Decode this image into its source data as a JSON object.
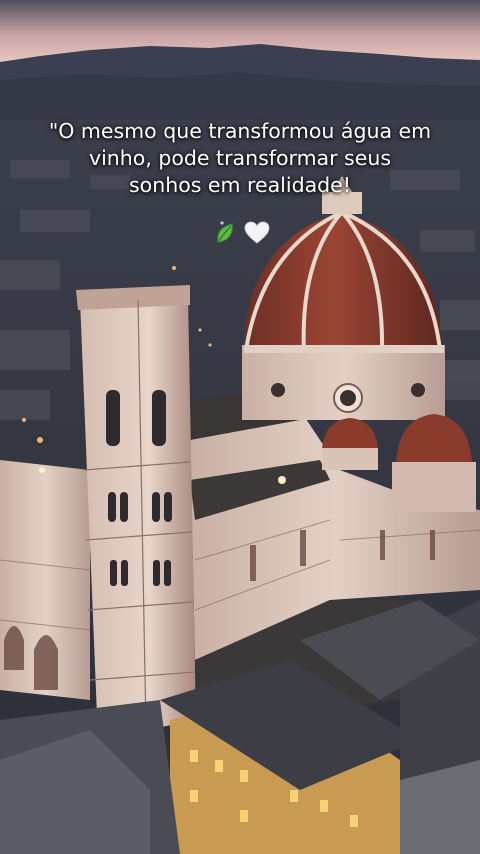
{
  "caption": {
    "lines": [
      "\"O mesmo que transformou água em",
      "vinho, pode transformar seus",
      "sonhos em realidade!"
    ]
  },
  "emojis": [
    {
      "icon": "leaf-icon"
    },
    {
      "icon": "white-heart-icon"
    }
  ],
  "colors": {
    "sky_top": "#3f3f52",
    "sky_glow": "#e9bfb8",
    "dome": "#8a3b2c",
    "marble": "#d8c3b6",
    "city": "#3a3d4a",
    "window_light": "#f2c45a"
  }
}
